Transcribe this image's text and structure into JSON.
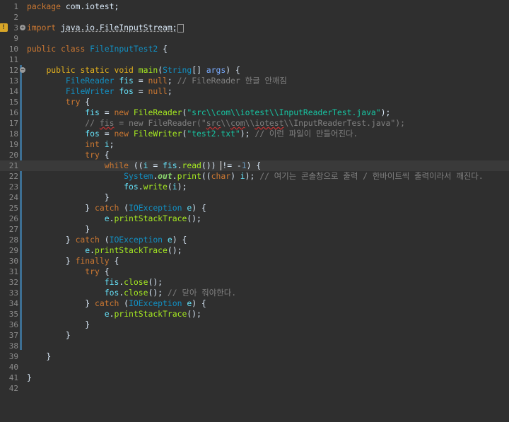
{
  "editor": {
    "lines": [
      {
        "n": "1",
        "tokens": [
          [
            "kw",
            "package"
          ],
          [
            "plain",
            " com.iotest;"
          ]
        ]
      },
      {
        "n": "2",
        "tokens": []
      },
      {
        "n": "3",
        "fold": true,
        "warn": true,
        "tokens": [
          [
            "kw",
            "import"
          ],
          [
            "plain",
            " "
          ],
          [
            "dotted",
            "java.io.FileInputStream;"
          ],
          [
            "box",
            ""
          ]
        ]
      },
      {
        "n": "9",
        "tokens": []
      },
      {
        "n": "10",
        "tokens": [
          [
            "kw",
            "public"
          ],
          [
            "plain",
            " "
          ],
          [
            "kw",
            "class"
          ],
          [
            "plain",
            " "
          ],
          [
            "type",
            "FileInputTest2"
          ],
          [
            "plain",
            " {"
          ]
        ]
      },
      {
        "n": "11",
        "tokens": []
      },
      {
        "n": "12",
        "fold": true,
        "tokens": [
          [
            "plain",
            "    "
          ],
          [
            "kw2",
            "public"
          ],
          [
            "plain",
            " "
          ],
          [
            "kw2",
            "static"
          ],
          [
            "plain",
            " "
          ],
          [
            "kw2",
            "void"
          ],
          [
            "plain",
            " "
          ],
          [
            "fn",
            "main"
          ],
          [
            "plain",
            "("
          ],
          [
            "type",
            "String"
          ],
          [
            "plain",
            "[] "
          ],
          [
            "var",
            "args"
          ],
          [
            "plain",
            ") {"
          ]
        ]
      },
      {
        "n": "13",
        "tokens": [
          [
            "plain",
            "        "
          ],
          [
            "type",
            "FileReader"
          ],
          [
            "plain",
            " "
          ],
          [
            "field",
            "fis"
          ],
          [
            "plain",
            " = "
          ],
          [
            "kw",
            "null"
          ],
          [
            "plain",
            "; "
          ],
          [
            "cm",
            "// FileReader 한글 안깨짐"
          ]
        ]
      },
      {
        "n": "14",
        "tokens": [
          [
            "plain",
            "        "
          ],
          [
            "type",
            "FileWriter"
          ],
          [
            "plain",
            " "
          ],
          [
            "field",
            "fos"
          ],
          [
            "plain",
            " = "
          ],
          [
            "kw",
            "null"
          ],
          [
            "plain",
            ";"
          ]
        ]
      },
      {
        "n": "15",
        "tokens": [
          [
            "plain",
            "        "
          ],
          [
            "kw",
            "try"
          ],
          [
            "plain",
            " {"
          ]
        ]
      },
      {
        "n": "16",
        "tokens": [
          [
            "plain",
            "            "
          ],
          [
            "field",
            "fis"
          ],
          [
            "plain",
            " = "
          ],
          [
            "kw",
            "new"
          ],
          [
            "plain",
            " "
          ],
          [
            "fn",
            "FileReader"
          ],
          [
            "plain",
            "("
          ],
          [
            "str",
            "\"src\\\\com\\\\iotest\\\\InputReaderTest.java\""
          ],
          [
            "plain",
            ");"
          ]
        ]
      },
      {
        "n": "17",
        "tokens": [
          [
            "plain",
            "            "
          ],
          [
            "cm",
            "// "
          ],
          [
            "cmsq",
            "fis"
          ],
          [
            "cm",
            " = new FileReader(\""
          ],
          [
            "cmsq",
            "src"
          ],
          [
            "cm",
            "\\\\"
          ],
          [
            "cmsq",
            "com"
          ],
          [
            "cm",
            "\\\\"
          ],
          [
            "cmsq",
            "iotest"
          ],
          [
            "cm",
            "\\\\InputReaderTest.java\");"
          ]
        ]
      },
      {
        "n": "18",
        "tokens": [
          [
            "plain",
            "            "
          ],
          [
            "field",
            "fos"
          ],
          [
            "plain",
            " = "
          ],
          [
            "kw",
            "new"
          ],
          [
            "plain",
            " "
          ],
          [
            "fn",
            "FileWriter"
          ],
          [
            "plain",
            "("
          ],
          [
            "str",
            "\"test2.txt\""
          ],
          [
            "plain",
            "); "
          ],
          [
            "cm",
            "// 이런 파일이 만들어진다."
          ]
        ]
      },
      {
        "n": "19",
        "tokens": [
          [
            "plain",
            "            "
          ],
          [
            "kw",
            "int"
          ],
          [
            "plain",
            " "
          ],
          [
            "field",
            "i"
          ],
          [
            "plain",
            ";"
          ]
        ]
      },
      {
        "n": "20",
        "tokens": [
          [
            "plain",
            "            "
          ],
          [
            "kw",
            "try"
          ],
          [
            "plain",
            " {"
          ]
        ]
      },
      {
        "n": "21",
        "current": true,
        "tokens": [
          [
            "plain",
            "                "
          ],
          [
            "kw",
            "while"
          ],
          [
            "plain",
            " (("
          ],
          [
            "field",
            "i"
          ],
          [
            "plain",
            " = "
          ],
          [
            "field",
            "fis"
          ],
          [
            "plain",
            "."
          ],
          [
            "fn",
            "read"
          ],
          [
            "plain",
            "()) "
          ],
          [
            "caret",
            ""
          ],
          [
            "plain",
            "!= -"
          ],
          [
            "num",
            "1"
          ],
          [
            "plain",
            ") {"
          ]
        ]
      },
      {
        "n": "22",
        "tokens": [
          [
            "plain",
            "                    "
          ],
          [
            "type",
            "System"
          ],
          [
            "plain",
            "."
          ],
          [
            "fielditalic",
            "out"
          ],
          [
            "plain",
            "."
          ],
          [
            "fn",
            "print"
          ],
          [
            "plain",
            "(("
          ],
          [
            "kw",
            "char"
          ],
          [
            "plain",
            ") "
          ],
          [
            "field",
            "i"
          ],
          [
            "plain",
            "); "
          ],
          [
            "cm",
            "// 여기는 콘솔창으로 출력 / 한바이트씩 출력이라서 깨진다."
          ]
        ]
      },
      {
        "n": "23",
        "tokens": [
          [
            "plain",
            "                    "
          ],
          [
            "field",
            "fos"
          ],
          [
            "plain",
            "."
          ],
          [
            "fn",
            "write"
          ],
          [
            "plain",
            "("
          ],
          [
            "field",
            "i"
          ],
          [
            "plain",
            ");"
          ]
        ]
      },
      {
        "n": "24",
        "tokens": [
          [
            "plain",
            "                }"
          ]
        ]
      },
      {
        "n": "25",
        "tokens": [
          [
            "plain",
            "            } "
          ],
          [
            "kw",
            "catch"
          ],
          [
            "plain",
            " ("
          ],
          [
            "type",
            "IOException"
          ],
          [
            "plain",
            " "
          ],
          [
            "field",
            "e"
          ],
          [
            "plain",
            ") {"
          ]
        ]
      },
      {
        "n": "26",
        "tokens": [
          [
            "plain",
            "                "
          ],
          [
            "field",
            "e"
          ],
          [
            "plain",
            "."
          ],
          [
            "fn",
            "printStackTrace"
          ],
          [
            "plain",
            "();"
          ]
        ]
      },
      {
        "n": "27",
        "tokens": [
          [
            "plain",
            "            }"
          ]
        ]
      },
      {
        "n": "28",
        "tokens": [
          [
            "plain",
            "        } "
          ],
          [
            "kw",
            "catch"
          ],
          [
            "plain",
            " ("
          ],
          [
            "type",
            "IOException"
          ],
          [
            "plain",
            " "
          ],
          [
            "field",
            "e"
          ],
          [
            "plain",
            ") {"
          ]
        ]
      },
      {
        "n": "29",
        "tokens": [
          [
            "plain",
            "            "
          ],
          [
            "field",
            "e"
          ],
          [
            "plain",
            "."
          ],
          [
            "fn",
            "printStackTrace"
          ],
          [
            "plain",
            "();"
          ]
        ]
      },
      {
        "n": "30",
        "tokens": [
          [
            "plain",
            "        } "
          ],
          [
            "kw",
            "finally"
          ],
          [
            "plain",
            " {"
          ]
        ]
      },
      {
        "n": "31",
        "tokens": [
          [
            "plain",
            "            "
          ],
          [
            "kw",
            "try"
          ],
          [
            "plain",
            " {"
          ]
        ]
      },
      {
        "n": "32",
        "tokens": [
          [
            "plain",
            "                "
          ],
          [
            "field",
            "fis"
          ],
          [
            "plain",
            "."
          ],
          [
            "fn",
            "close"
          ],
          [
            "plain",
            "();"
          ]
        ]
      },
      {
        "n": "33",
        "tokens": [
          [
            "plain",
            "                "
          ],
          [
            "field",
            "fos"
          ],
          [
            "plain",
            "."
          ],
          [
            "fn",
            "close"
          ],
          [
            "plain",
            "(); "
          ],
          [
            "cm",
            "// 닫아 줘야한다."
          ]
        ]
      },
      {
        "n": "34",
        "tokens": [
          [
            "plain",
            "            } "
          ],
          [
            "kw",
            "catch"
          ],
          [
            "plain",
            " ("
          ],
          [
            "type",
            "IOException"
          ],
          [
            "plain",
            " "
          ],
          [
            "field",
            "e"
          ],
          [
            "plain",
            ") {"
          ]
        ]
      },
      {
        "n": "35",
        "tokens": [
          [
            "plain",
            "                "
          ],
          [
            "field",
            "e"
          ],
          [
            "plain",
            "."
          ],
          [
            "fn",
            "printStackTrace"
          ],
          [
            "plain",
            "();"
          ]
        ]
      },
      {
        "n": "36",
        "tokens": [
          [
            "plain",
            "            }"
          ]
        ]
      },
      {
        "n": "37",
        "tokens": [
          [
            "plain",
            "        }"
          ]
        ]
      },
      {
        "n": "38",
        "tokens": []
      },
      {
        "n": "39",
        "tokens": [
          [
            "plain",
            "    }"
          ]
        ]
      },
      {
        "n": "40",
        "tokens": []
      },
      {
        "n": "41",
        "tokens": [
          [
            "plain",
            "}"
          ]
        ]
      },
      {
        "n": "42",
        "tokens": []
      }
    ]
  }
}
